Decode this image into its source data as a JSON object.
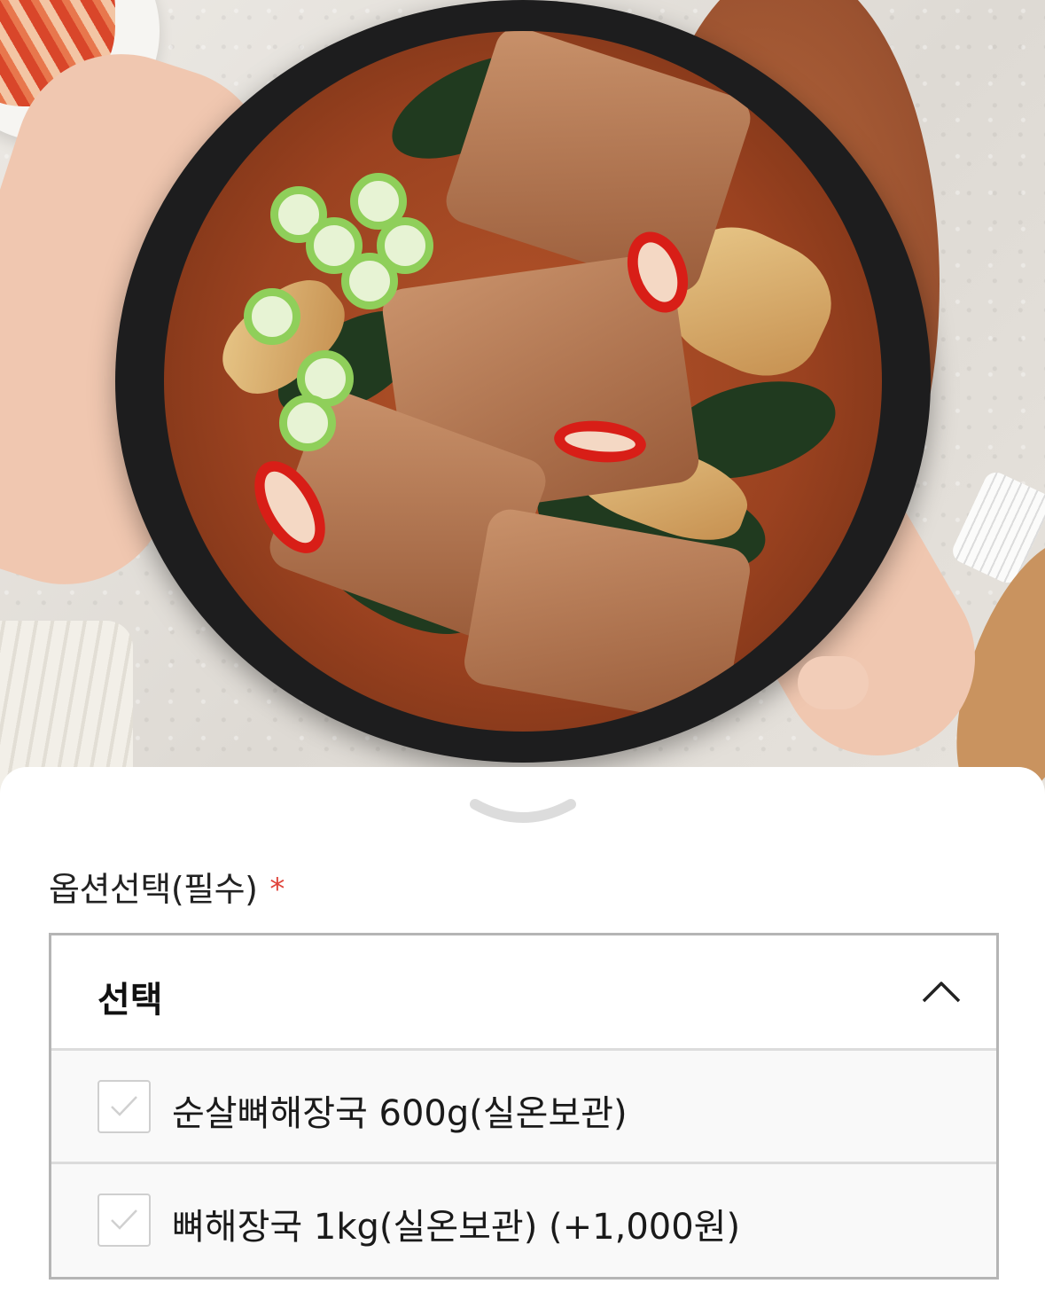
{
  "option_sheet": {
    "label": "옵션선택(필수)",
    "required_mark": "*",
    "select": {
      "value": "선택",
      "expanded": true,
      "options": [
        {
          "label": "순살뼈해장국 600g(실온보관)",
          "checked": false
        },
        {
          "label": "뼈해장국 1kg(실온보관) (+1,000원)",
          "checked": false
        }
      ]
    }
  },
  "colors": {
    "required": "#e0443b",
    "border": "#b5b5b5",
    "checkmark": "#d0d0d0"
  }
}
